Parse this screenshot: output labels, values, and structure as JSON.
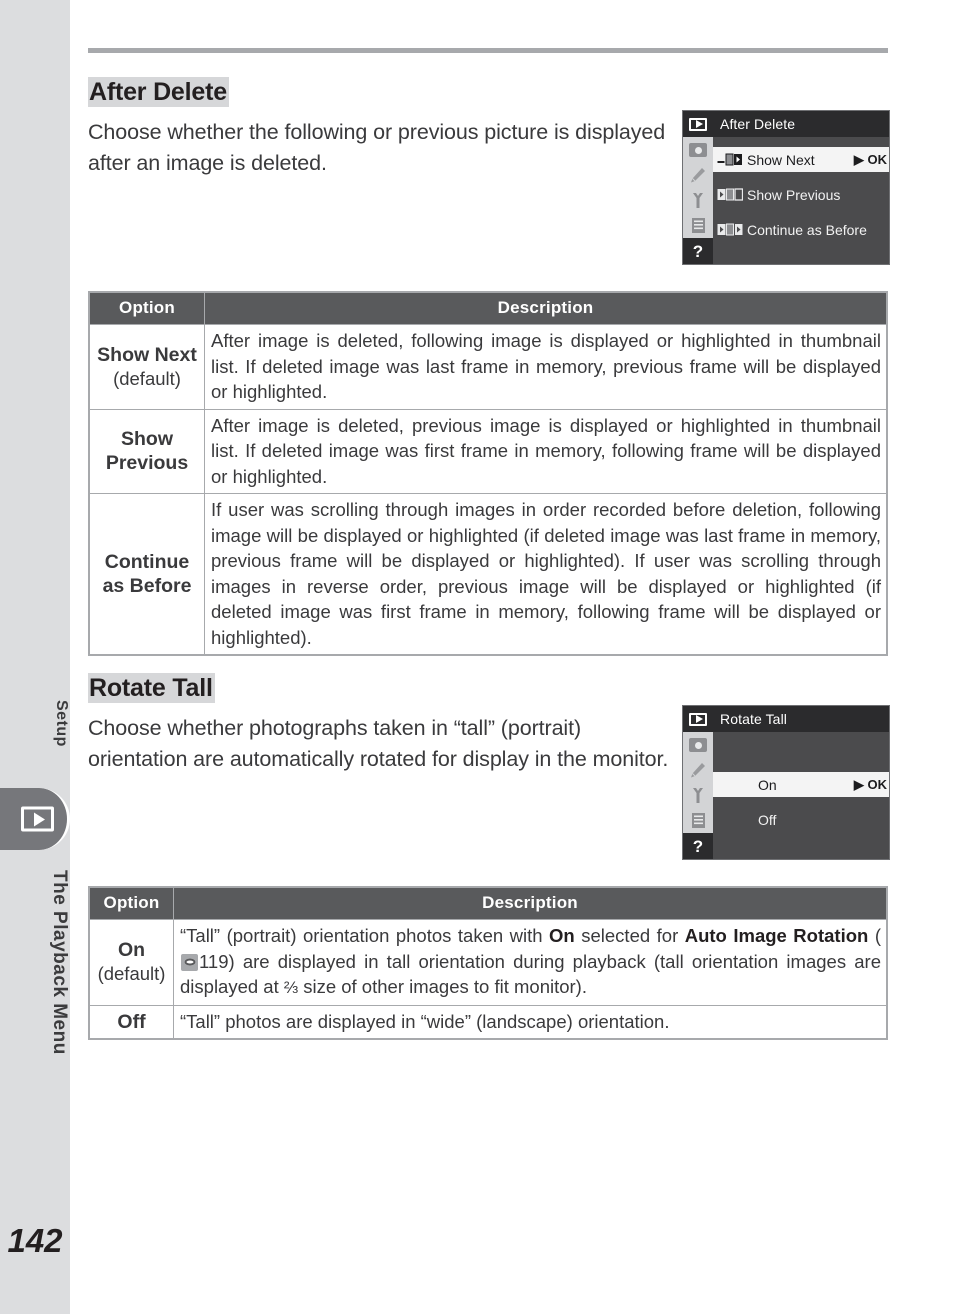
{
  "page": {
    "number": "142",
    "side_tabs": {
      "upper_label": "Setup",
      "lower_label": "The Playback Menu",
      "active_icon": "playback-icon"
    }
  },
  "sections": [
    {
      "heading": "After Delete",
      "lead": "Choose whether the following or previous picture is displayed after an image is deleted.",
      "screen": {
        "title": "After Delete",
        "side_icons": [
          "playback-icon",
          "shooting-menu-icon",
          "pencil-icon",
          "wrench-icon",
          "recent-settings-icon",
          "help-icon"
        ],
        "help_glyph": "?",
        "ok_label": "OK",
        "items": [
          {
            "label": "Show Next",
            "selected": true,
            "icon": "show-next-icon"
          },
          {
            "label": "Show Previous",
            "selected": false,
            "icon": "show-previous-icon"
          },
          {
            "label": "Continue as Before",
            "selected": false,
            "icon": "continue-as-before-icon"
          }
        ]
      },
      "table": {
        "headers": [
          "Option",
          "Description"
        ],
        "rows": [
          {
            "option": "Show Next",
            "default_note": "(default)",
            "description": "After image is deleted, following image is displayed or highlighted in thumbnail list.  If deleted image was last frame in memory, previous frame will be displayed or highlighted."
          },
          {
            "option": "Show Previous",
            "default_note": "",
            "description": "After image is deleted, previous image is displayed or highlighted in thumbnail list.  If deleted image was first frame in memory, following frame will be displayed or highlighted."
          },
          {
            "option": "Continue as Before",
            "default_note": "",
            "description": "If user was scrolling through images in order recorded before deletion, following image will be displayed or highlighted (if deleted image was last frame in memory, previous frame will be displayed or highlighted).  If user was scrolling through images in reverse order, previous image will be displayed or highlighted (if deleted image was first frame in memory, following frame will be displayed or highlighted)."
          }
        ]
      }
    },
    {
      "heading": "Rotate Tall",
      "lead": "Choose whether photographs taken in “tall” (portrait) orientation are automatically rotated for display in the monitor.",
      "screen": {
        "title": "Rotate Tall",
        "side_icons": [
          "playback-icon",
          "shooting-menu-icon",
          "pencil-icon",
          "wrench-icon",
          "recent-settings-icon",
          "help-icon"
        ],
        "help_glyph": "?",
        "ok_label": "OK",
        "items": [
          {
            "label": "On",
            "selected": true,
            "icon": ""
          },
          {
            "label": "Off",
            "selected": false,
            "icon": ""
          }
        ]
      },
      "table": {
        "headers": [
          "Option",
          "Description"
        ],
        "rows": [
          {
            "option": "On",
            "default_note": "(default)",
            "description_parts": {
              "p1": "“Tall” (portrait) orientation photos taken with ",
              "b1": "On",
              "p2": " selected for ",
              "b2": "Auto Image Rotation",
              "p3": " (",
              "ref_icon": "see-also-eye-icon",
              "ref_page": "119",
              "p4": ") are displayed in tall orientation during playback (tall orientation images are displayed at ",
              "frac": "⅔",
              "p5": " size of other images to fit monitor)."
            }
          },
          {
            "option": "Off",
            "default_note": "",
            "description": "“Tall” photos are displayed in “wide” (landscape) orientation."
          }
        ]
      }
    }
  ]
}
